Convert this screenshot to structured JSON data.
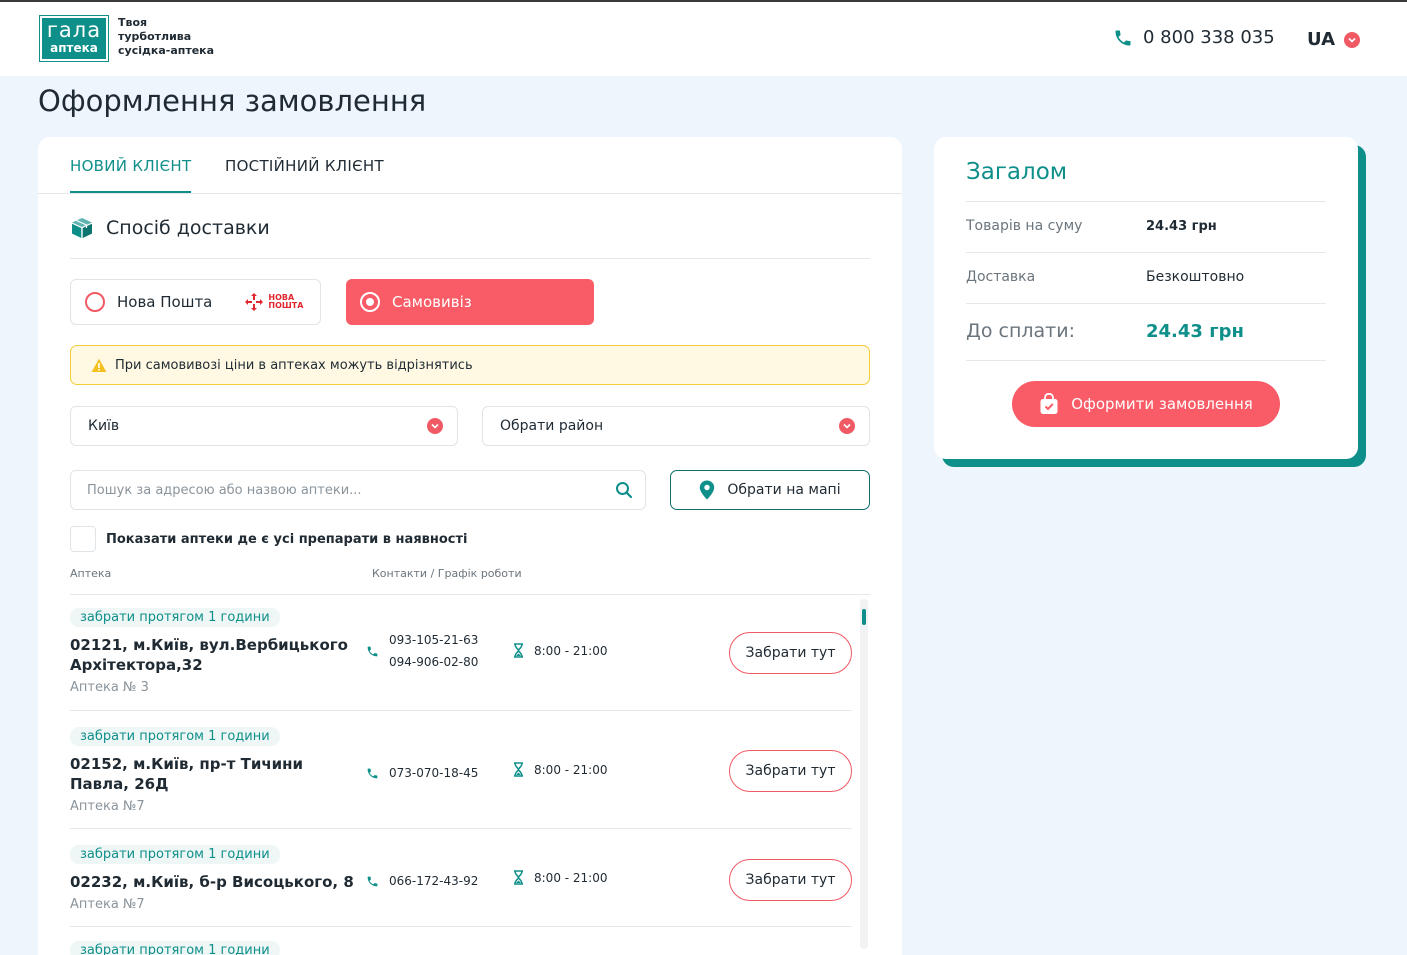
{
  "header": {
    "logo_top": "гала",
    "logo_bottom": "аптека",
    "tagline": [
      "Твоя",
      "турботлива",
      "сусідка-аптека"
    ],
    "phone": "0 800 338 035",
    "language": "UA"
  },
  "page_title": "Оформлення замовлення",
  "tabs": [
    {
      "label": "НОВИЙ КЛІЄНТ",
      "active": true
    },
    {
      "label": "ПОСТІЙНИЙ КЛІЄНТ",
      "active": false
    }
  ],
  "delivery": {
    "section_title": "Спосіб доставки",
    "options": [
      {
        "label": "Нова Пошта",
        "selected": false,
        "brand": [
          "НОВА",
          "ПОШТА"
        ]
      },
      {
        "label": "Самовивіз",
        "selected": true
      }
    ],
    "warning": "При самовивозі ціни в аптеках можуть відрізнятись",
    "city": "Київ",
    "district_placeholder": "Обрати район",
    "search_placeholder": "Пошук за адресою або назвою аптеки...",
    "map_button": "Обрати на мапі",
    "checkbox_label": "Показати аптеки де є усі препарати в наявності"
  },
  "pharmacy_list": {
    "columns": [
      "Аптека",
      "Контакти / Графік роботи"
    ],
    "rows": [
      {
        "badge": "забрати протягом 1 години",
        "address": "02121, м.Київ, вул.Вербицького Архітектора,32",
        "name": "Аптека № 3",
        "phones": [
          "093-105-21-63",
          "094-906-02-80"
        ],
        "hours": "8:00 - 21:00",
        "button": "Забрати тут"
      },
      {
        "badge": "забрати протягом 1 години",
        "address": "02152, м.Київ, пр-т Тичини Павла, 26Д",
        "name": "Аптека №7",
        "phones": [
          "073-070-18-45"
        ],
        "hours": "8:00 - 21:00",
        "button": "Забрати тут"
      },
      {
        "badge": "забрати протягом 1 години",
        "address": "02232, м.Київ, б-р Висоцького, 8",
        "name": "Аптека №7",
        "phones": [
          "066-172-43-92"
        ],
        "hours": "8:00 - 21:00",
        "button": "Забрати тут"
      },
      {
        "badge": "забрати протягом 1 години"
      }
    ]
  },
  "summary": {
    "title": "Загалом",
    "goods_label": "Товарів на суму",
    "goods_value": "24.43 грн",
    "delivery_label": "Доставка",
    "delivery_value": "Безкоштовно",
    "total_label": "До сплати:",
    "total_value": "24.43 грн",
    "order_button": "Оформити замовлення"
  },
  "colors": {
    "brand_teal": "#0f8f8a",
    "accent_red": "#f95c66",
    "warning_bg": "#fff8e3",
    "page_bg": "#eef5fc"
  }
}
